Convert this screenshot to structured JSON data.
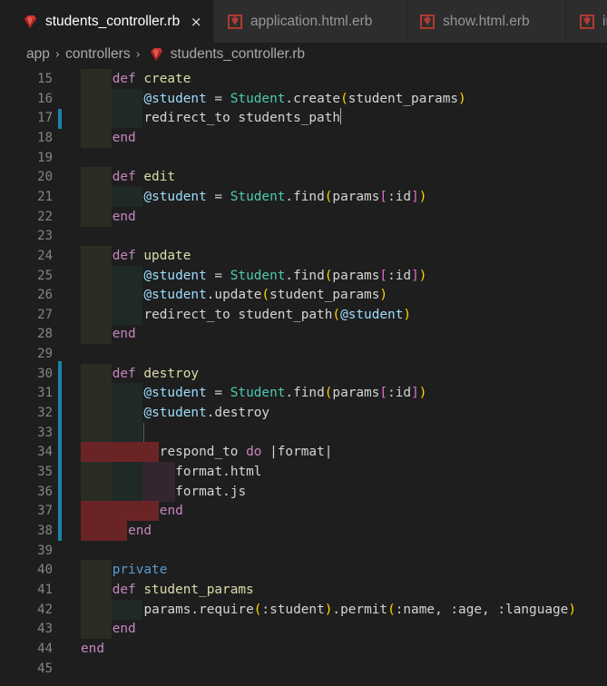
{
  "tabs": [
    {
      "label": "students_controller.rb",
      "active": true,
      "icon": "ruby-icon",
      "close": "×"
    },
    {
      "label": "application.html.erb",
      "active": false,
      "icon": "erb-icon"
    },
    {
      "label": "show.html.erb",
      "active": false,
      "icon": "erb-icon"
    },
    {
      "label": "in",
      "active": false,
      "icon": "erb-icon"
    }
  ],
  "breadcrumb": {
    "items": [
      "app",
      "controllers",
      "students_controller.rb"
    ],
    "separator": "›"
  },
  "colors": {
    "keyword": "#c586c0",
    "function_name": "#dcdcaa",
    "instance_var": "#9cdcfe",
    "class_name": "#4ec9b0",
    "modified_marker": "#1b81a8"
  },
  "lines": [
    {
      "n": "15",
      "text": "def create"
    },
    {
      "n": "16",
      "text": "@student = Student.create(student_params)"
    },
    {
      "n": "17",
      "text": "redirect_to students_path"
    },
    {
      "n": "18",
      "text": "end"
    },
    {
      "n": "19",
      "text": ""
    },
    {
      "n": "20",
      "text": "def edit"
    },
    {
      "n": "21",
      "text": "@student = Student.find(params[:id])"
    },
    {
      "n": "22",
      "text": "end"
    },
    {
      "n": "23",
      "text": ""
    },
    {
      "n": "24",
      "text": "def update"
    },
    {
      "n": "25",
      "text": "@student = Student.find(params[:id])"
    },
    {
      "n": "26",
      "text": "@student.update(student_params)"
    },
    {
      "n": "27",
      "text": "redirect_to student_path(@student)"
    },
    {
      "n": "28",
      "text": "end"
    },
    {
      "n": "29",
      "text": ""
    },
    {
      "n": "30",
      "text": "def destroy"
    },
    {
      "n": "31",
      "text": "@student = Student.find(params[:id])"
    },
    {
      "n": "32",
      "text": "@student.destroy"
    },
    {
      "n": "33",
      "text": ""
    },
    {
      "n": "34",
      "text": "respond_to do |format|"
    },
    {
      "n": "35",
      "text": "format.html"
    },
    {
      "n": "36",
      "text": "format.js"
    },
    {
      "n": "37",
      "text": "end"
    },
    {
      "n": "38",
      "text": "end"
    },
    {
      "n": "39",
      "text": ""
    },
    {
      "n": "40",
      "text": "private"
    },
    {
      "n": "41",
      "text": "def student_params"
    },
    {
      "n": "42",
      "text": "params.require(:student).permit(:name, :age, :language)"
    },
    {
      "n": "43",
      "text": "end"
    },
    {
      "n": "44",
      "text": "end"
    },
    {
      "n": "45",
      "text": ""
    }
  ]
}
